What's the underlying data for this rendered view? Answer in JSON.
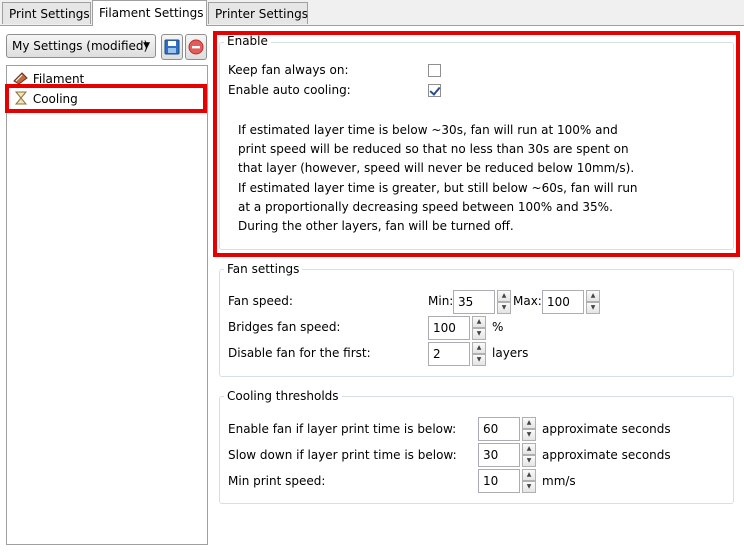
{
  "tabs": [
    "Print Settings",
    "Filament Settings",
    "Printer Settings"
  ],
  "preset": {
    "selected": "My Settings (modified)"
  },
  "tree": {
    "items": [
      "Filament",
      "Cooling"
    ]
  },
  "enable": {
    "title": "Enable",
    "keep_fan_label": "Keep fan always on:",
    "keep_fan_checked": false,
    "auto_cooling_label": "Enable auto cooling:",
    "auto_cooling_checked": true,
    "description": [
      "If estimated layer time is below ~30s, fan will run at 100% and",
      "print speed will be reduced so that no less than 30s are spent on",
      "that layer (however, speed will never be reduced below 10mm/s).",
      "If estimated layer time is greater, but still below ~60s, fan will run",
      "at a proportionally decreasing speed between 100% and 35%.",
      "During the other layers, fan will be turned off."
    ]
  },
  "fan": {
    "title": "Fan settings",
    "fan_speed_label": "Fan speed:",
    "min_label": "Min:",
    "min_value": "35",
    "max_label": "Max:",
    "max_value": "100",
    "bridges_label": "Bridges fan speed:",
    "bridges_value": "100",
    "bridges_unit": "%",
    "disable_label": "Disable fan for the first:",
    "disable_value": "2",
    "disable_unit": "layers"
  },
  "thresholds": {
    "title": "Cooling thresholds",
    "enable_label": "Enable fan if layer print time is below:",
    "enable_value": "60",
    "enable_unit": "approximate seconds",
    "slow_label": "Slow down if layer print time is below:",
    "slow_value": "30",
    "slow_unit": "approximate seconds",
    "min_speed_label": "Min print speed:",
    "min_speed_value": "10",
    "min_speed_unit": "mm/s"
  },
  "colors": {
    "highlight": "#e60000",
    "group_border": "#d5dfe5"
  }
}
